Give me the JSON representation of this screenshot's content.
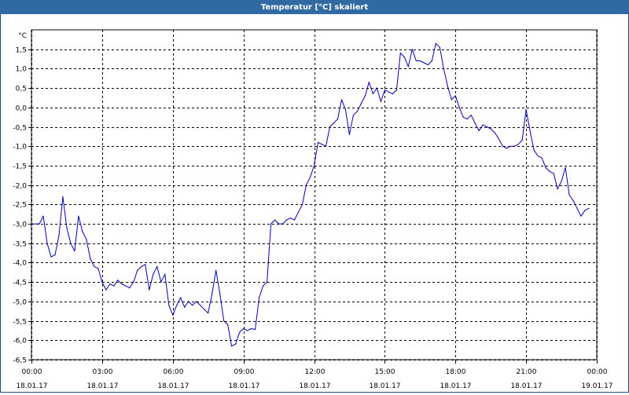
{
  "window": {
    "title": "Temperatur [°C] skaliert"
  },
  "colors": {
    "titlebar": "#2f6aa3",
    "line": "#0000b4",
    "grid": "#000000"
  },
  "chart_data": {
    "type": "line",
    "title": "Temperatur [°C] skaliert",
    "xlabel": "",
    "ylabel": "°C",
    "ylim": [
      -6.5,
      2.0
    ],
    "xlim": [
      "18.01.17 00:00",
      "19.01.17 00:00"
    ],
    "grid": true,
    "y_ticks": [
      "1,5",
      "1,0",
      "0,5",
      "0,0",
      "-0,5",
      "-1,0",
      "-1,5",
      "-2,0",
      "-2,5",
      "-3,0",
      "-3,5",
      "-4,0",
      "-4,5",
      "-5,0",
      "-5,5",
      "-6,0",
      "-6,5"
    ],
    "x_ticks": [
      {
        "time": "00:00",
        "date": "18.01.17"
      },
      {
        "time": "03:00",
        "date": "18.01.17"
      },
      {
        "time": "06:00",
        "date": "18.01.17"
      },
      {
        "time": "09:00",
        "date": "18.01.17"
      },
      {
        "time": "12:00",
        "date": "18.01.17"
      },
      {
        "time": "15:00",
        "date": "18.01.17"
      },
      {
        "time": "18:00",
        "date": "18.01.17"
      },
      {
        "time": "21:00",
        "date": "18.01.17"
      },
      {
        "time": "00:00",
        "date": "19.01.17"
      }
    ],
    "series": [
      {
        "values": [
          [
            "18.01.17 00:00",
            -3.0
          ],
          [
            "18.01.17 00:20",
            -3.0
          ],
          [
            "18.01.17 00:30",
            -2.8
          ],
          [
            "18.01.17 00:40",
            -3.5
          ],
          [
            "18.01.17 00:50",
            -3.85
          ],
          [
            "18.01.17 01:00",
            -3.8
          ],
          [
            "18.01.17 01:10",
            -3.3
          ],
          [
            "18.01.17 01:20",
            -2.3
          ],
          [
            "18.01.17 01:30",
            -3.1
          ],
          [
            "18.01.17 01:40",
            -3.5
          ],
          [
            "18.01.17 01:50",
            -3.7
          ],
          [
            "18.01.17 02:00",
            -2.8
          ],
          [
            "18.01.17 02:10",
            -3.2
          ],
          [
            "18.01.17 02:20",
            -3.4
          ],
          [
            "18.01.17 02:30",
            -3.9
          ],
          [
            "18.01.17 02:40",
            -4.1
          ],
          [
            "18.01.17 02:50",
            -4.15
          ],
          [
            "18.01.17 03:00",
            -4.5
          ],
          [
            "18.01.17 03:10",
            -4.7
          ],
          [
            "18.01.17 03:20",
            -4.55
          ],
          [
            "18.01.17 03:30",
            -4.6
          ],
          [
            "18.01.17 03:40",
            -4.45
          ],
          [
            "18.01.17 03:50",
            -4.55
          ],
          [
            "18.01.17 04:00",
            -4.6
          ],
          [
            "18.01.17 04:10",
            -4.65
          ],
          [
            "18.01.17 04:20",
            -4.5
          ],
          [
            "18.01.17 04:30",
            -4.2
          ],
          [
            "18.01.17 04:40",
            -4.1
          ],
          [
            "18.01.17 04:50",
            -4.05
          ],
          [
            "18.01.17 05:00",
            -4.7
          ],
          [
            "18.01.17 05:10",
            -4.3
          ],
          [
            "18.01.17 05:20",
            -4.1
          ],
          [
            "18.01.17 05:30",
            -4.5
          ],
          [
            "18.01.17 05:40",
            -4.3
          ],
          [
            "18.01.17 05:50",
            -5.1
          ],
          [
            "18.01.17 06:00",
            -5.35
          ],
          [
            "18.01.17 06:10",
            -5.1
          ],
          [
            "18.01.17 06:20",
            -4.9
          ],
          [
            "18.01.17 06:30",
            -5.15
          ],
          [
            "18.01.17 06:40",
            -5.0
          ],
          [
            "18.01.17 06:50",
            -5.1
          ],
          [
            "18.01.17 07:00",
            -5.0
          ],
          [
            "18.01.17 07:10",
            -5.1
          ],
          [
            "18.01.17 07:20",
            -5.2
          ],
          [
            "18.01.17 07:30",
            -5.3
          ],
          [
            "18.01.17 07:40",
            -4.8
          ],
          [
            "18.01.17 07:50",
            -4.2
          ],
          [
            "18.01.17 08:00",
            -4.8
          ],
          [
            "18.01.17 08:10",
            -5.5
          ],
          [
            "18.01.17 08:20",
            -5.6
          ],
          [
            "18.01.17 08:30",
            -6.15
          ],
          [
            "18.01.17 08:40",
            -6.1
          ],
          [
            "18.01.17 08:50",
            -5.8
          ],
          [
            "18.01.17 09:00",
            -5.7
          ],
          [
            "18.01.17 09:10",
            -5.75
          ],
          [
            "18.01.17 09:20",
            -5.7
          ],
          [
            "18.01.17 09:30",
            -5.72
          ],
          [
            "18.01.17 09:40",
            -4.9
          ],
          [
            "18.01.17 09:50",
            -4.6
          ],
          [
            "18.01.17 10:00",
            -4.5
          ],
          [
            "18.01.17 10:10",
            -3.0
          ],
          [
            "18.01.17 10:20",
            -2.9
          ],
          [
            "18.01.17 10:30",
            -3.0
          ],
          [
            "18.01.17 10:40",
            -3.0
          ],
          [
            "18.01.17 10:50",
            -2.9
          ],
          [
            "18.01.17 11:00",
            -2.85
          ],
          [
            "18.01.17 11:10",
            -2.9
          ],
          [
            "18.01.17 11:20",
            -2.7
          ],
          [
            "18.01.17 11:30",
            -2.5
          ],
          [
            "18.01.17 11:40",
            -2.0
          ],
          [
            "18.01.17 11:50",
            -1.8
          ],
          [
            "18.01.17 12:00",
            -1.5
          ],
          [
            "18.01.17 12:10",
            -0.9
          ],
          [
            "18.01.17 12:20",
            -0.95
          ],
          [
            "18.01.17 12:30",
            -1.0
          ],
          [
            "18.01.17 12:40",
            -0.5
          ],
          [
            "18.01.17 12:50",
            -0.4
          ],
          [
            "18.01.17 13:00",
            -0.3
          ],
          [
            "18.01.17 13:10",
            0.2
          ],
          [
            "18.01.17 13:20",
            -0.05
          ],
          [
            "18.01.17 13:30",
            -0.7
          ],
          [
            "18.01.17 13:40",
            -0.2
          ],
          [
            "18.01.17 13:50",
            -0.1
          ],
          [
            "18.01.17 14:00",
            0.1
          ],
          [
            "18.01.17 14:10",
            0.3
          ],
          [
            "18.01.17 14:20",
            0.65
          ],
          [
            "18.01.17 14:30",
            0.35
          ],
          [
            "18.01.17 14:40",
            0.5
          ],
          [
            "18.01.17 14:50",
            0.15
          ],
          [
            "18.01.17 15:00",
            0.45
          ],
          [
            "18.01.17 15:10",
            0.4
          ],
          [
            "18.01.17 15:20",
            0.35
          ],
          [
            "18.01.17 15:30",
            0.45
          ],
          [
            "18.01.17 15:40",
            1.4
          ],
          [
            "18.01.17 15:50",
            1.3
          ],
          [
            "18.01.17 16:00",
            1.05
          ],
          [
            "18.01.17 16:10",
            1.5
          ],
          [
            "18.01.17 16:20",
            1.2
          ],
          [
            "18.01.17 16:30",
            1.2
          ],
          [
            "18.01.17 16:40",
            1.15
          ],
          [
            "18.01.17 16:50",
            1.1
          ],
          [
            "18.01.17 17:00",
            1.2
          ],
          [
            "18.01.17 17:10",
            1.65
          ],
          [
            "18.01.17 17:20",
            1.55
          ],
          [
            "18.01.17 17:30",
            1.0
          ],
          [
            "18.01.17 17:40",
            0.55
          ],
          [
            "18.01.17 17:50",
            0.2
          ],
          [
            "18.01.17 18:00",
            0.3
          ],
          [
            "18.01.17 18:10",
            0.0
          ],
          [
            "18.01.17 18:20",
            -0.25
          ],
          [
            "18.01.17 18:30",
            -0.3
          ],
          [
            "18.01.17 18:40",
            -0.2
          ],
          [
            "18.01.17 18:50",
            -0.4
          ],
          [
            "18.01.17 19:00",
            -0.6
          ],
          [
            "18.01.17 19:10",
            -0.45
          ],
          [
            "18.01.17 19:20",
            -0.5
          ],
          [
            "18.01.17 19:30",
            -0.55
          ],
          [
            "18.01.17 19:40",
            -0.65
          ],
          [
            "18.01.17 19:50",
            -0.8
          ],
          [
            "18.01.17 20:00",
            -1.0
          ],
          [
            "18.01.17 20:10",
            -1.05
          ],
          [
            "18.01.17 20:20",
            -1.0
          ],
          [
            "18.01.17 20:30",
            -1.0
          ],
          [
            "18.01.17 20:40",
            -0.95
          ],
          [
            "18.01.17 20:50",
            -0.85
          ],
          [
            "18.01.17 21:00",
            -0.05
          ],
          [
            "18.01.17 21:10",
            -0.6
          ],
          [
            "18.01.17 21:20",
            -1.1
          ],
          [
            "18.01.17 21:30",
            -1.25
          ],
          [
            "18.01.17 21:40",
            -1.3
          ],
          [
            "18.01.17 21:50",
            -1.55
          ],
          [
            "18.01.17 22:00",
            -1.65
          ],
          [
            "18.01.17 22:10",
            -1.7
          ],
          [
            "18.01.17 22:20",
            -2.1
          ],
          [
            "18.01.17 22:30",
            -1.9
          ],
          [
            "18.01.17 22:40",
            -1.55
          ],
          [
            "18.01.17 22:50",
            -2.25
          ],
          [
            "18.01.17 23:00",
            -2.4
          ],
          [
            "18.01.17 23:10",
            -2.6
          ],
          [
            "18.01.17 23:20",
            -2.8
          ],
          [
            "18.01.17 23:30",
            -2.65
          ],
          [
            "18.01.17 23:40",
            -2.6
          ]
        ]
      }
    ]
  }
}
